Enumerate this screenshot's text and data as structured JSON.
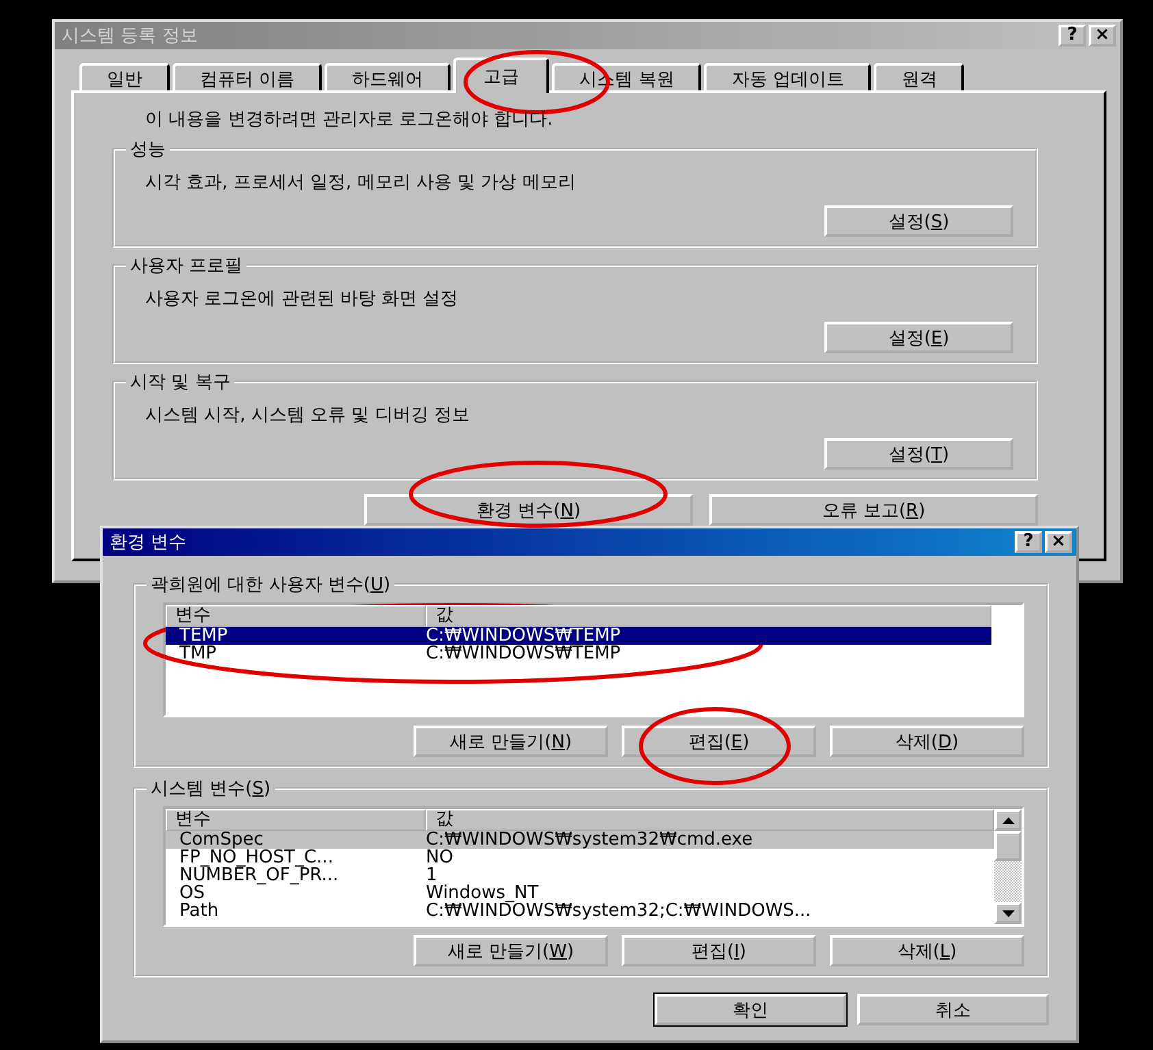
{
  "back_window": {
    "title": "시스템 등록 정보",
    "help_button": "?",
    "close_button": "×",
    "tabs": [
      {
        "label": "일반",
        "selected": false
      },
      {
        "label": "컴퓨터 이름",
        "selected": false
      },
      {
        "label": "하드웨어",
        "selected": false
      },
      {
        "label": "고급",
        "selected": true
      },
      {
        "label": "시스템 복원",
        "selected": false
      },
      {
        "label": "자동 업데이트",
        "selected": false
      },
      {
        "label": "원격",
        "selected": false
      }
    ],
    "notice": "이 내용을 변경하려면 관리자로 로그온해야 합니다.",
    "groups": [
      {
        "title": "성능",
        "description": "시각 효과, 프로세서 일정, 메모리 사용 및 가상 메모리",
        "button": [
          "설정(",
          "S",
          ")"
        ]
      },
      {
        "title": "사용자 프로필",
        "description": "사용자 로그온에 관련된 바탕 화면 설정",
        "button": [
          "설정(",
          "E",
          ")"
        ]
      },
      {
        "title": "시작 및 복구",
        "description": "시스템 시작, 시스템 오류 및 디버깅 정보",
        "button": [
          "설정(",
          "T",
          ")"
        ]
      }
    ],
    "buttons": [
      [
        "환경 변수(",
        "N",
        ")"
      ],
      [
        "오류 보고(",
        "R",
        ")"
      ]
    ]
  },
  "front_window": {
    "title": "환경 변수",
    "help_button": "?",
    "close_button": "×",
    "user_vars": {
      "title": [
        "곽희원에 대한 사용자 변수(",
        "U",
        ")"
      ],
      "columns": [
        "변수",
        "값"
      ],
      "rows": [
        {
          "name": "TEMP",
          "value": "C:₩WINDOWS₩TEMP",
          "selected": true
        },
        {
          "name": "TMP",
          "value": "C:₩WINDOWS₩TEMP",
          "selected": false
        }
      ],
      "buttons": [
        [
          "새로 만들기(",
          "N",
          ")"
        ],
        [
          "편집(",
          "E",
          ")"
        ],
        [
          "삭제(",
          "D",
          ")"
        ]
      ]
    },
    "system_vars": {
      "title": [
        "시스템 변수(",
        "S",
        ")"
      ],
      "columns": [
        "변수",
        "값"
      ],
      "rows": [
        {
          "name": "ComSpec",
          "value": "C:₩WINDOWS₩system32₩cmd.exe",
          "selected": true
        },
        {
          "name": "FP_NO_HOST_C...",
          "value": "NO",
          "selected": false
        },
        {
          "name": "NUMBER_OF_PR...",
          "value": "1",
          "selected": false
        },
        {
          "name": "OS",
          "value": "Windows_NT",
          "selected": false
        },
        {
          "name": "Path",
          "value": "C:₩WINDOWS₩system32;C:₩WINDOWS...",
          "selected": false
        }
      ],
      "buttons": [
        [
          "새로 만들기(",
          "W",
          ")"
        ],
        [
          "편집(",
          "I",
          ")"
        ],
        [
          "삭제(",
          "L",
          ")"
        ]
      ]
    },
    "ok": "확인",
    "cancel": "취소"
  }
}
